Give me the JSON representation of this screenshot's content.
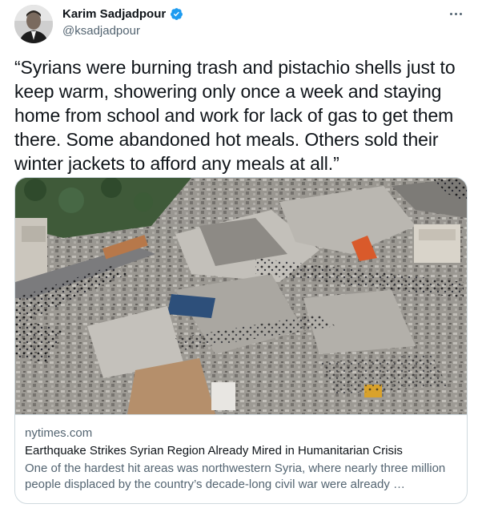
{
  "author": {
    "name": "Karim Sadjadpour",
    "handle": "@ksadjadpour",
    "verified": true,
    "verified_color": "#1d9bf0",
    "avatar_icon": "avatar-photo"
  },
  "menu": {
    "icon": "more-horizontal-icon"
  },
  "tweet": {
    "text": "“Syrians were burning trash and pistachio shells just to keep warm, showering only once a week and staying home from school and work for lack of gas to get them there. Some abandoned hot meals. Others sold their winter jackets to afford any meals at all.”"
  },
  "link_card": {
    "domain": "nytimes.com",
    "title": "Earthquake Strikes Syrian Region Already Mired in Humanitarian Crisis",
    "description": "One of the hardest hit areas was northwestern Syria, where nearly three million people displaced by the country’s decade-long civil war were already …"
  },
  "colors": {
    "text_primary": "#0f1419",
    "text_secondary": "#536471",
    "border": "#cfd9de"
  }
}
